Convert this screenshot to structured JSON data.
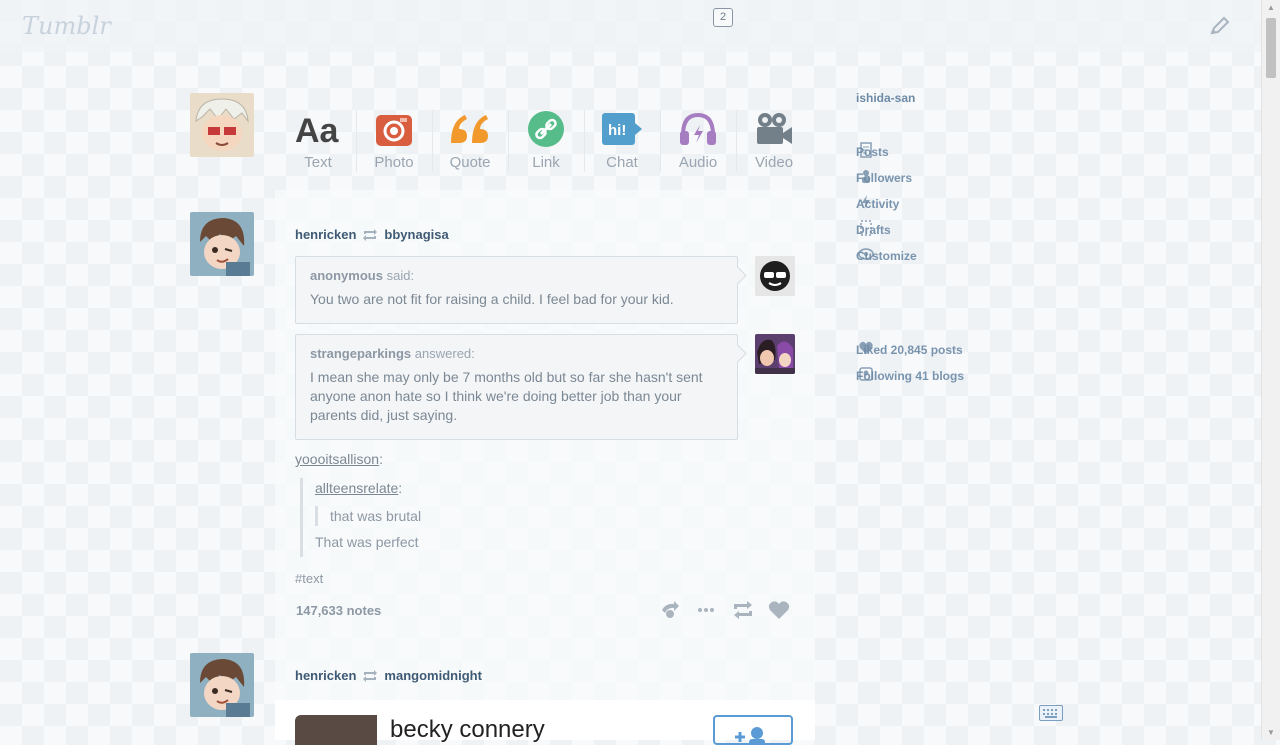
{
  "header": {
    "logo": "Tumblr",
    "inbox_count": "2"
  },
  "post_types": [
    {
      "label": "Text",
      "icon": "text-icon",
      "color": "#444444"
    },
    {
      "label": "Photo",
      "icon": "camera-icon",
      "color": "#d95e40"
    },
    {
      "label": "Quote",
      "icon": "quote-icon",
      "color": "#f2992e"
    },
    {
      "label": "Link",
      "icon": "link-icon",
      "color": "#56bc8a"
    },
    {
      "label": "Chat",
      "icon": "chat-icon",
      "color": "#529ecc"
    },
    {
      "label": "Audio",
      "icon": "headphones-icon",
      "color": "#a77dc2"
    },
    {
      "label": "Video",
      "icon": "video-camera-icon",
      "color": "#748089"
    }
  ],
  "post1": {
    "author": "henricken",
    "reblogged_from": "bbynagisa",
    "ask": {
      "asker": "anonymous",
      "said": "said:",
      "question": "You two are not fit for raising a child. I feel bad for your kid."
    },
    "answer": {
      "answerer": "strangeparkings",
      "answered": "answered:",
      "text": "I mean she may only be 7 months old but so far she hasn't sent anyone anon hate so I think we're doing better job than your parents did, just saying."
    },
    "reblog_user": "yoooitsallison",
    "reblog_colon": ":",
    "nested_user": "allteensrelate",
    "nested_colon": ":",
    "nested_quote": "that was brutal",
    "nested_reply": "That was perfect",
    "tag": "#text",
    "notes": "147,633 notes"
  },
  "post2": {
    "author": "henricken",
    "reblogged_from": "mangomidnight",
    "card_title": "becky connery"
  },
  "sidebar": {
    "blog_name": "ishida-san",
    "menu": [
      {
        "label": "Posts",
        "icon": "posts-icon"
      },
      {
        "label": "Followers",
        "icon": "followers-icon"
      },
      {
        "label": "Activity",
        "icon": "activity-icon"
      },
      {
        "label": "Drafts",
        "icon": "drafts-icon"
      },
      {
        "label": "Customize",
        "icon": "customize-icon"
      }
    ],
    "stats": [
      {
        "label": "Liked 20,845 posts",
        "icon": "heart-icon"
      },
      {
        "label": "Following 41 blogs",
        "icon": "following-icon"
      }
    ]
  }
}
